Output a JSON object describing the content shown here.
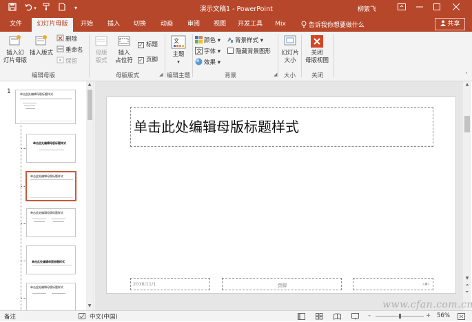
{
  "app": {
    "window_title": "演示文稿1  -  PowerPoint",
    "user": "柳絮飞"
  },
  "quick_access": {
    "save": "save-icon",
    "undo": "undo-icon",
    "format_painter": "format-painter-icon",
    "new": "new-document-icon",
    "customize": "▾"
  },
  "tabs": [
    "文件",
    "幻灯片母版",
    "开始",
    "插入",
    "切换",
    "动画",
    "审阅",
    "视图",
    "开发工具",
    "Mix"
  ],
  "active_tab": "幻灯片母版",
  "tell_me": "告诉我你想要做什么",
  "share": "共享",
  "ribbon": {
    "edit_master": {
      "insert_slide_master": "插入幻\n灯片母版",
      "insert_layout": "插入版式",
      "delete": "删除",
      "rename": "重命名",
      "preserve": "保留",
      "group_label": "编辑母版"
    },
    "master_layout": {
      "master_layout_btn": "母版\n版式",
      "insert_placeholder": "插入\n占位符",
      "title_check": "标题",
      "footer_check": "页脚",
      "group_label": "母版版式"
    },
    "edit_theme": {
      "themes": "主题",
      "group_label": "编辑主题"
    },
    "background": {
      "colors": "颜色",
      "fonts": "字体",
      "effects": "效果",
      "background_styles": "背景样式",
      "hide_background": "隐藏背景图形",
      "group_label": "背景"
    },
    "size": {
      "slide_size": "幻灯片\n大小",
      "group_label": "大小"
    },
    "close": {
      "close_master_view": "关闭\n母版视图",
      "group_label": "关闭"
    }
  },
  "thumbnails": {
    "master_number": "1",
    "master_title": "单击此处编辑母版标题样式",
    "layout_title": "单击此处编辑母版标题样式"
  },
  "slide": {
    "title": "单击此处编辑母版标题样式",
    "date": "2016/11/1",
    "footer": "页脚",
    "number": "‹#›"
  },
  "status": {
    "notes": "备注",
    "language": "中文(中国)",
    "zoom": "56%"
  },
  "watermark": "www.cfan.com.cn",
  "colors": {
    "brand": "#B7472A",
    "selection": "#C55A3A",
    "close_red": "#D24726"
  }
}
